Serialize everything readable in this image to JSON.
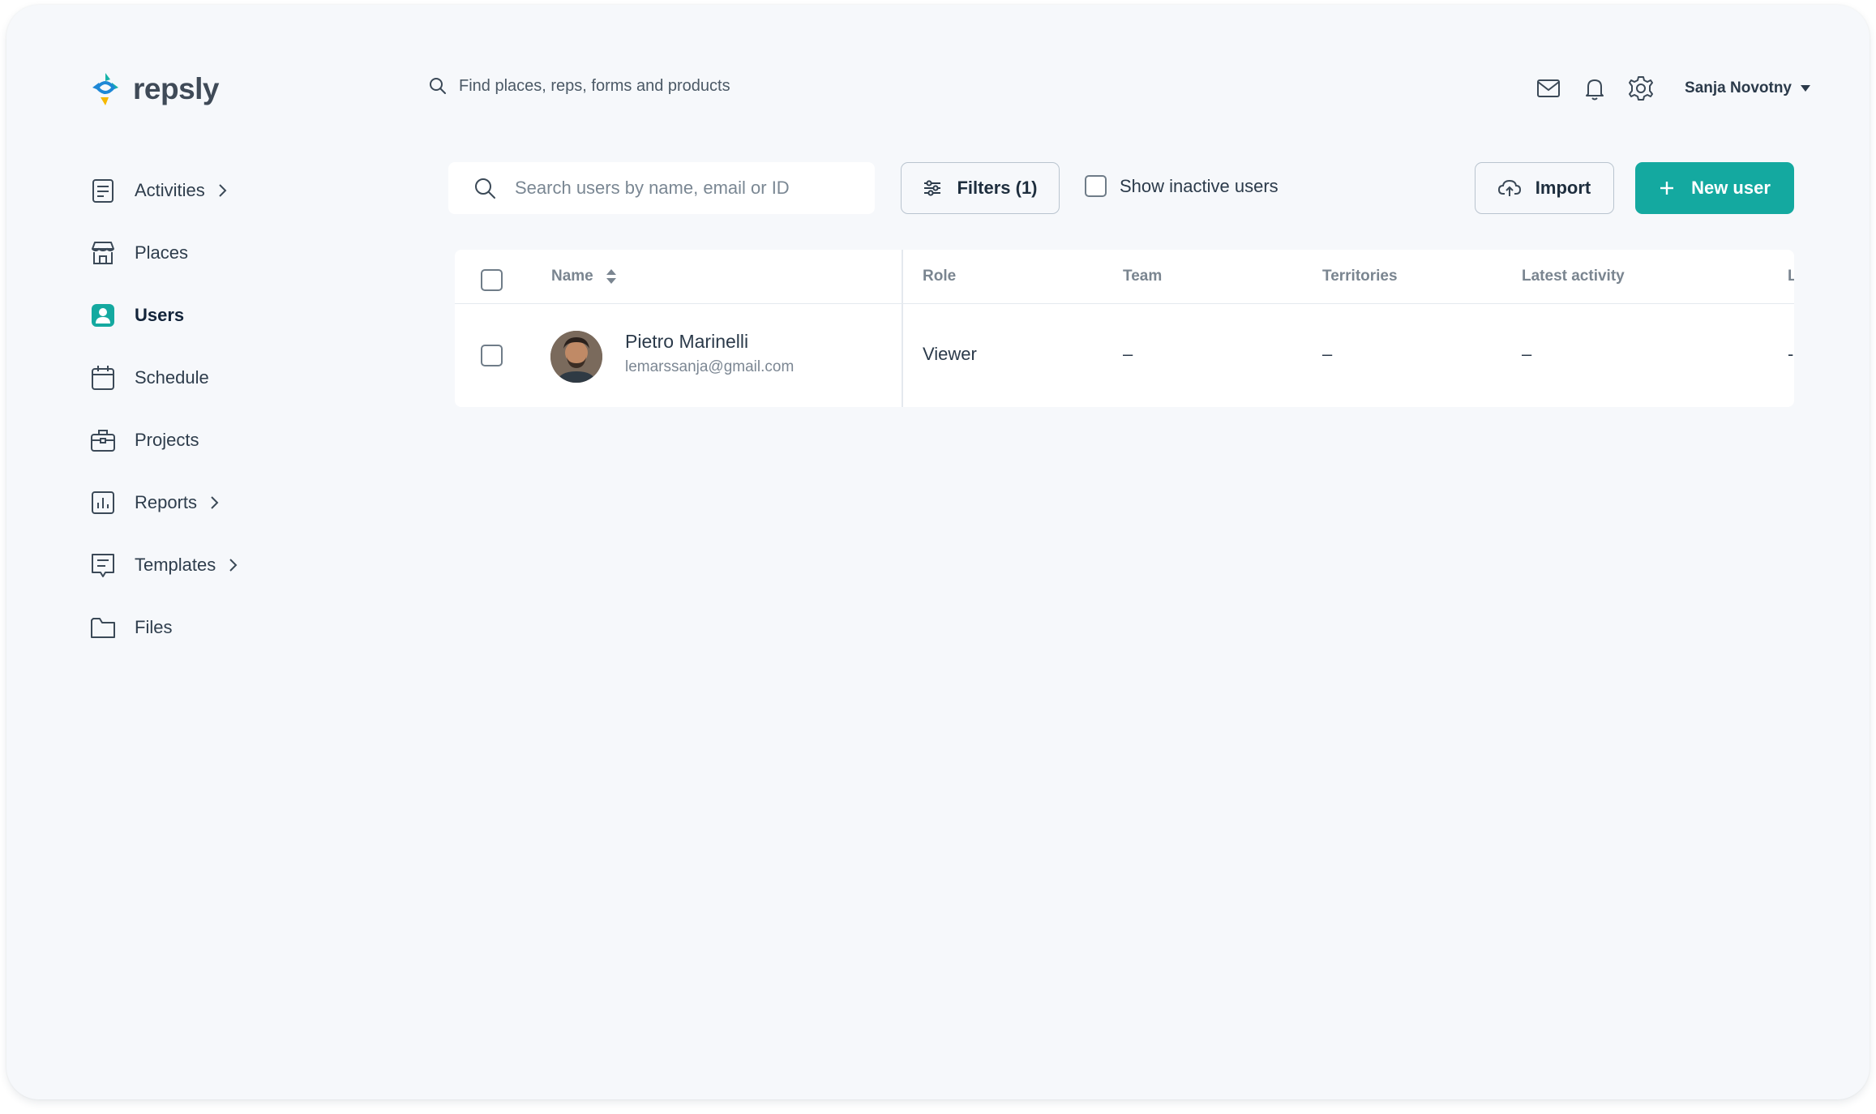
{
  "app": {
    "logo_text": "repsly",
    "brand_color": "#14a9a0"
  },
  "header": {
    "search_placeholder": "Find places, reps, forms and products",
    "user_name": "Sanja Novotny",
    "icons": [
      "mail-icon",
      "bell-icon",
      "gear-icon"
    ]
  },
  "sidebar": {
    "items": [
      {
        "label": "Activities",
        "icon": "activities-icon",
        "has_submenu": true
      },
      {
        "label": "Places",
        "icon": "store-icon",
        "has_submenu": false
      },
      {
        "label": "Users",
        "icon": "user-icon",
        "has_submenu": false,
        "active": true
      },
      {
        "label": "Schedule",
        "icon": "calendar-icon",
        "has_submenu": false
      },
      {
        "label": "Projects",
        "icon": "briefcase-icon",
        "has_submenu": false
      },
      {
        "label": "Reports",
        "icon": "chart-icon",
        "has_submenu": true
      },
      {
        "label": "Templates",
        "icon": "template-icon",
        "has_submenu": true
      },
      {
        "label": "Files",
        "icon": "folder-icon",
        "has_submenu": false
      }
    ]
  },
  "toolbar": {
    "search_placeholder": "Search users by name, email or ID",
    "filters_label": "Filters (1)",
    "inactive_label": "Show inactive users",
    "import_label": "Import",
    "new_user_label": "New user"
  },
  "table": {
    "columns": [
      "Name",
      "Role",
      "Team",
      "Territories",
      "Latest activity",
      "L"
    ],
    "rows": [
      {
        "name": "Pietro Marinelli",
        "email": "lemarssanja@gmail.com",
        "role": "Viewer",
        "team": "–",
        "territories": "–",
        "latest_activity": "–",
        "extra": "-"
      }
    ]
  }
}
